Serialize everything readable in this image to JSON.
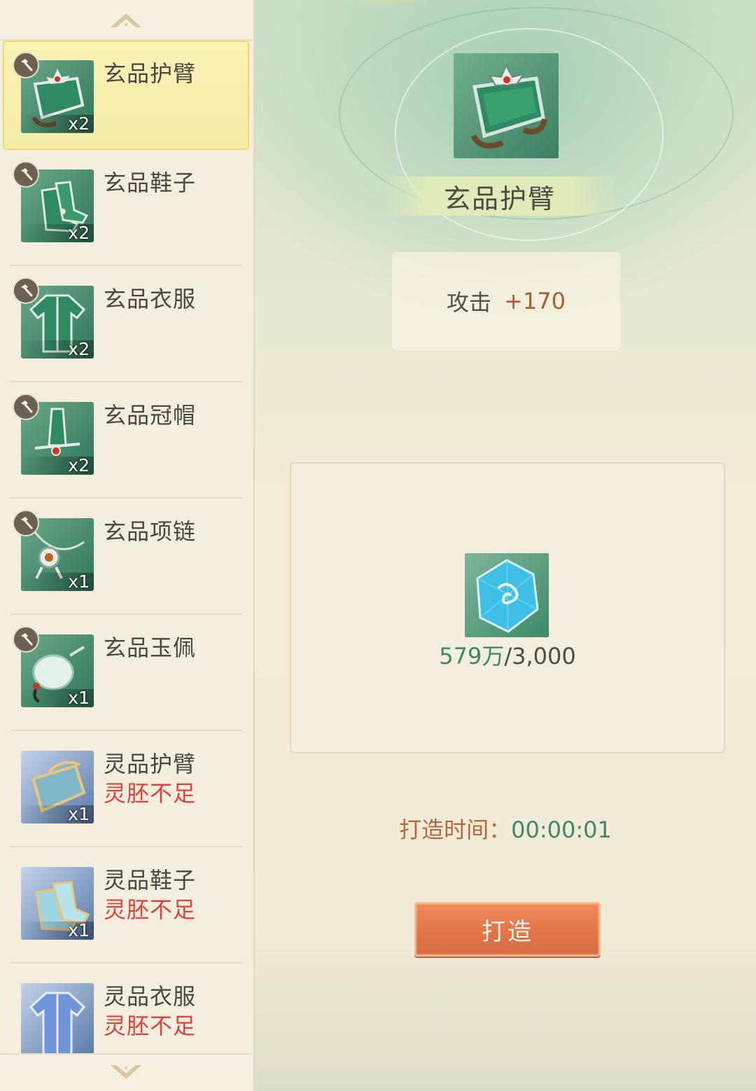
{
  "list": {
    "items": [
      {
        "name": "玄品护臂",
        "count": "x2",
        "status": "",
        "tier": "green",
        "selected": true,
        "icon": "bracer-icon"
      },
      {
        "name": "玄品鞋子",
        "count": "x2",
        "status": "",
        "tier": "green",
        "selected": false,
        "icon": "boots-icon"
      },
      {
        "name": "玄品衣服",
        "count": "x2",
        "status": "",
        "tier": "green",
        "selected": false,
        "icon": "robe-icon"
      },
      {
        "name": "玄品冠帽",
        "count": "x2",
        "status": "",
        "tier": "green",
        "selected": false,
        "icon": "crown-icon"
      },
      {
        "name": "玄品项链",
        "count": "x1",
        "status": "",
        "tier": "green",
        "selected": false,
        "icon": "necklace-icon"
      },
      {
        "name": "玄品玉佩",
        "count": "x1",
        "status": "",
        "tier": "green",
        "selected": false,
        "icon": "jade-pendant-icon"
      },
      {
        "name": "灵品护臂",
        "count": "x1",
        "status": "灵胚不足",
        "tier": "blue",
        "selected": false,
        "icon": "bracer-icon"
      },
      {
        "name": "灵品鞋子",
        "count": "x1",
        "status": "灵胚不足",
        "tier": "blue",
        "selected": false,
        "icon": "boots-icon"
      },
      {
        "name": "灵品衣服",
        "count": "",
        "status": "灵胚不足",
        "tier": "blue",
        "selected": false,
        "icon": "robe-icon"
      }
    ]
  },
  "detail": {
    "title": "玄品护臂",
    "stat_label": "攻击",
    "stat_value": "+170",
    "material_have": "579万",
    "material_need": "/3,000",
    "craft_time_label": "打造时间：",
    "craft_time_value": "00:00:01",
    "craft_button": "打造"
  },
  "colors": {
    "green_text": "#3f8a66",
    "warning_red": "#e0423f",
    "button_orange": "#e07447",
    "selected_bg": "#f8efae"
  }
}
